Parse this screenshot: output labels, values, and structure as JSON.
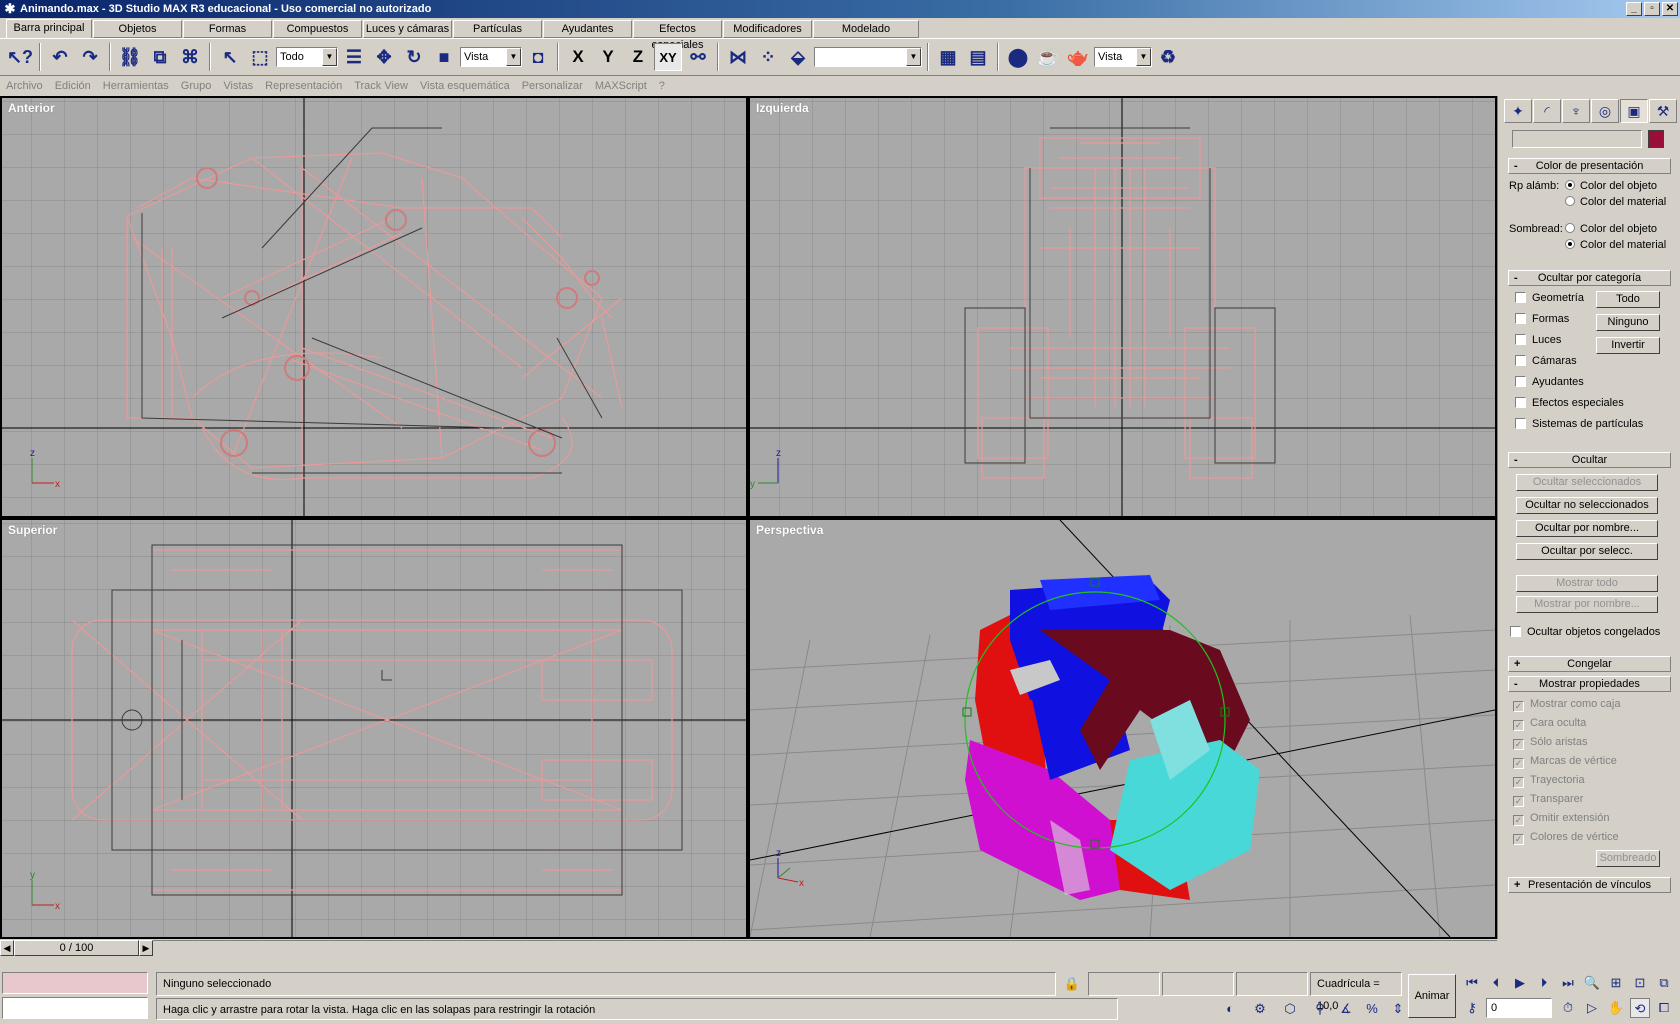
{
  "window": {
    "title": "Animando.max - 3D Studio MAX R3 educacional - Uso comercial no autorizado",
    "btn_min": "_",
    "btn_max": "▫",
    "btn_close": "✕"
  },
  "tabs": [
    "Barra principal",
    "Objetos",
    "Formas",
    "Compuestos",
    "Luces y cámaras",
    "Partículas",
    "Ayudantes",
    "Efectos especiales",
    "Modificadores",
    "Modelado"
  ],
  "toolbar": {
    "select_filter": "Todo",
    "coord_system": "Vista",
    "named_selection": "",
    "render_view": "Vista",
    "axis_x": "X",
    "axis_y": "Y",
    "axis_z": "Z",
    "axis_xy": "XY"
  },
  "menu": [
    "Archivo",
    "Edición",
    "Herramientas",
    "Grupo",
    "Vistas",
    "Representación",
    "Track View",
    "Vista esquemática",
    "Personalizar",
    "MAXScript",
    "?"
  ],
  "viewports": {
    "front": "Anterior",
    "left": "Izquierda",
    "top": "Superior",
    "perspective": "Perspectiva",
    "axis_x": "x",
    "axis_y": "y",
    "axis_z": "z"
  },
  "panel": {
    "rollout_display_color": "Color de presentación",
    "wire_label": "Rp alámb:",
    "shaded_label": "Sombread:",
    "object_color": "Color del objeto",
    "material_color": "Color del material",
    "rollout_hide_category": "Ocultar por categoría",
    "categories": [
      "Geometría",
      "Formas",
      "Luces",
      "Cámaras",
      "Ayudantes",
      "Efectos especiales",
      "Sistemas de partículas"
    ],
    "btn_all": "Todo",
    "btn_none": "Ninguno",
    "btn_invert": "Invertir",
    "rollout_hide": "Ocultar",
    "hide_selected": "Ocultar seleccionados",
    "hide_unselected": "Ocultar no seleccionados",
    "hide_by_name": "Ocultar por nombre...",
    "hide_by_hit": "Ocultar por selecc.",
    "unhide_all": "Mostrar todo",
    "unhide_by_name": "Mostrar por nombre...",
    "hide_frozen": "Ocultar objetos congelados",
    "rollout_freeze": "Congelar",
    "rollout_display_props": "Mostrar propiedades",
    "props": [
      "Mostrar como caja",
      "Cara oculta",
      "Sólo aristas",
      "Marcas de vértice",
      "Trayectoria",
      "Transparer",
      "Omitir extensión",
      "Colores de vértice"
    ],
    "btn_shaded": "Sombreado",
    "rollout_link": "Presentación de vínculos",
    "plus": "+",
    "minus": "-"
  },
  "status": {
    "frame": "0 / 100",
    "selection": "Ninguno seleccionado",
    "prompt": "Haga clic y arrastre para rotar la vista. Haga clic en las solapas para restringir la rotación",
    "grid": "Cuadrícula = 10,0",
    "animate": "Animar",
    "frame_field": "0"
  },
  "colors": {
    "wireframe": "#e89a9a",
    "viewport_bg": "#a9a9a9",
    "title_grad_start": "#0a246a"
  }
}
